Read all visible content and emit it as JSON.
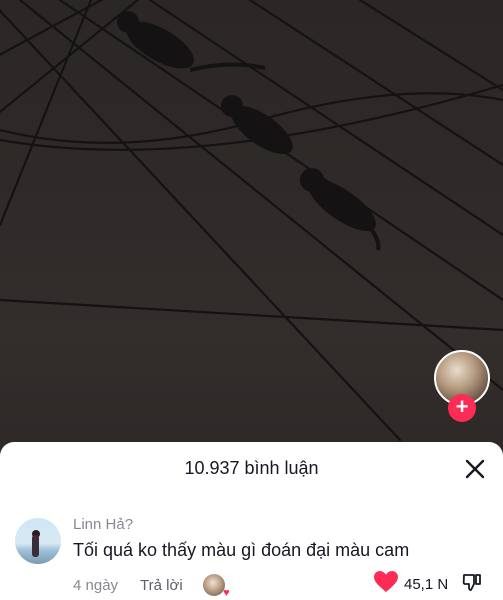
{
  "video": {
    "background_color": "#2a2625",
    "creator_avatar_icon": "creator-avatar",
    "follow_symbol": "+"
  },
  "comments_sheet": {
    "title": "10.937 bình luận",
    "close_icon": "close-icon"
  },
  "comment": {
    "username": "Linn Hả?",
    "text": "Tối quá ko thấy màu gì đoán đại màu cam",
    "time": "4 ngày",
    "reply_label": "Trả lời",
    "like_count": "45,1 N",
    "liked": true,
    "like_color": "#fe2c55",
    "creator_liked_icon": "creator-liked-avatar"
  }
}
